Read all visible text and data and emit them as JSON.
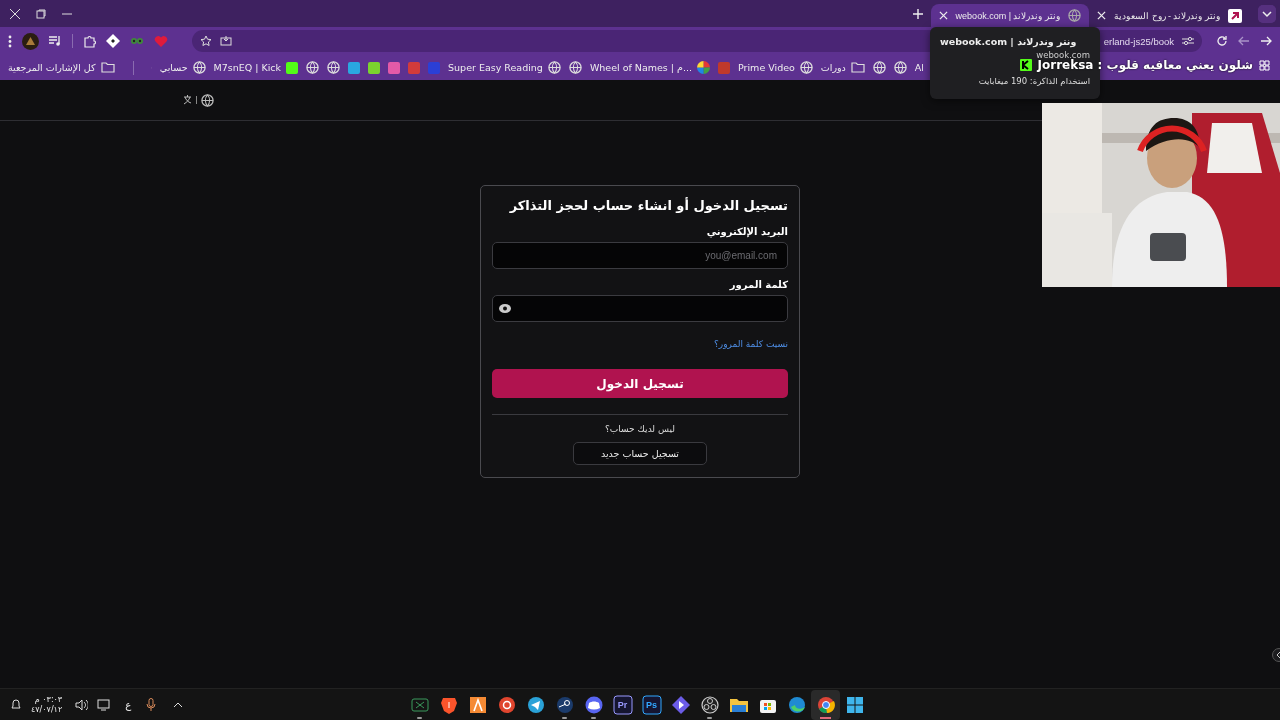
{
  "tabs": [
    {
      "title": "ونتر وندرلاند - روح السعودية",
      "kind": "brand",
      "selected": false
    },
    {
      "title": "webook.com | ونتر وندرلاند",
      "kind": "globe",
      "selected": true
    }
  ],
  "tab_tooltip": {
    "title": "webook.com | ونتر وندرلاند",
    "domain": "webook.com",
    "memory": "استخدام الذاكرة: 190 ميغابايت"
  },
  "address_bar": {
    "value": "erland-js25/book"
  },
  "bookmarks": [
    {
      "kind": "text",
      "label": "Al"
    },
    {
      "kind": "globe"
    },
    {
      "kind": "globe"
    },
    {
      "kind": "folder",
      "label": "دورات"
    },
    {
      "kind": "globe",
      "label": "Prime Video"
    },
    {
      "kind": "tile",
      "color": "#c0392b"
    },
    {
      "kind": "wheel",
      "label": "Wheel of Names | م..."
    },
    {
      "kind": "globe"
    },
    {
      "kind": "globe",
      "label": "Super Easy Reading"
    },
    {
      "kind": "tile",
      "color": "#2b3fd6"
    },
    {
      "kind": "tile",
      "color": "#d23b3b"
    },
    {
      "kind": "tile",
      "color": "#e35aa8"
    },
    {
      "kind": "tile",
      "color": "#7bd12f"
    },
    {
      "kind": "tile",
      "color": "#2aa7e0"
    },
    {
      "kind": "globe"
    },
    {
      "kind": "globe"
    },
    {
      "kind": "tile",
      "color": "#53fc18",
      "label": "M7snEQ | Kick"
    },
    {
      "kind": "globe",
      "label": "حسابي"
    }
  ],
  "all_bookmarks": "كل الإشارات المرجعية",
  "chat_overlay": {
    "message": "Jorreksa : شلون يعني معافيه قلوب"
  },
  "login": {
    "title": "تسجيل الدخول أو انشاء حساب لحجز التذاكر",
    "email_label": "البريد الإلكتروني",
    "email_placeholder": "you@email.com",
    "password_label": "كلمة المرور",
    "forgot": "نسيت كلمة المرور؟",
    "submit": "تسجيل الدخول",
    "no_account": "ليس لديك حساب؟",
    "register": "تسجيل حساب جديد"
  },
  "taskbar": {
    "time": "٠٣:٠٣ م",
    "date": "٤٧/٠٧/١٢",
    "language": "ع",
    "apps": [
      {
        "kind": "start",
        "running": false,
        "selected": false
      },
      {
        "kind": "chrome",
        "running": false,
        "selected": true
      },
      {
        "kind": "edge",
        "running": false,
        "selected": false
      },
      {
        "kind": "store",
        "running": false,
        "selected": false
      },
      {
        "kind": "files",
        "running": false,
        "selected": false
      },
      {
        "kind": "obs",
        "running": true,
        "selected": false
      },
      {
        "kind": "diamond",
        "running": false,
        "selected": false
      },
      {
        "kind": "letters",
        "label": "Ps",
        "color": "#31a8ff",
        "running": false,
        "selected": false
      },
      {
        "kind": "letters",
        "label": "Pr",
        "color": "#9999ff",
        "running": false,
        "selected": false
      },
      {
        "kind": "discord",
        "running": true,
        "selected": false
      },
      {
        "kind": "steam",
        "running": true,
        "selected": false
      },
      {
        "kind": "telegram",
        "running": false,
        "selected": false
      },
      {
        "kind": "redcircle",
        "running": false,
        "selected": false
      },
      {
        "kind": "orange",
        "running": false,
        "selected": false
      },
      {
        "kind": "brave",
        "running": false,
        "selected": false
      },
      {
        "kind": "xbox",
        "running": true,
        "selected": false
      }
    ]
  }
}
